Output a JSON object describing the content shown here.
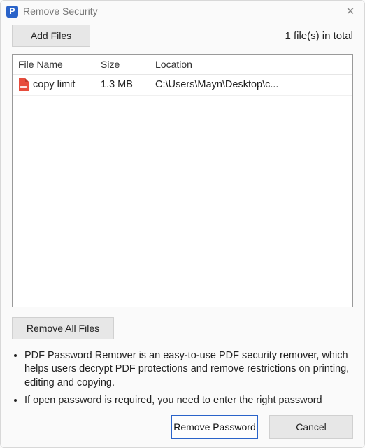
{
  "window": {
    "app_icon_letter": "P",
    "title": "Remove Security"
  },
  "toolbar": {
    "add_files_label": "Add Files",
    "total_text": "1 file(s) in total"
  },
  "table": {
    "headers": {
      "name": "File Name",
      "size": "Size",
      "location": "Location"
    },
    "rows": [
      {
        "name": "copy limit",
        "size": "1.3 MB",
        "location": "C:\\Users\\Mayn\\Desktop\\c..."
      }
    ]
  },
  "actions": {
    "remove_all_label": "Remove All Files",
    "remove_password_label": "Remove Password",
    "cancel_label": "Cancel"
  },
  "info": {
    "bullets": [
      "PDF Password Remover is an easy-to-use PDF security remover, which helps users decrypt PDF protections and remove restrictions on printing, editing and copying.",
      "If open password is required, you need to enter the right password"
    ]
  }
}
